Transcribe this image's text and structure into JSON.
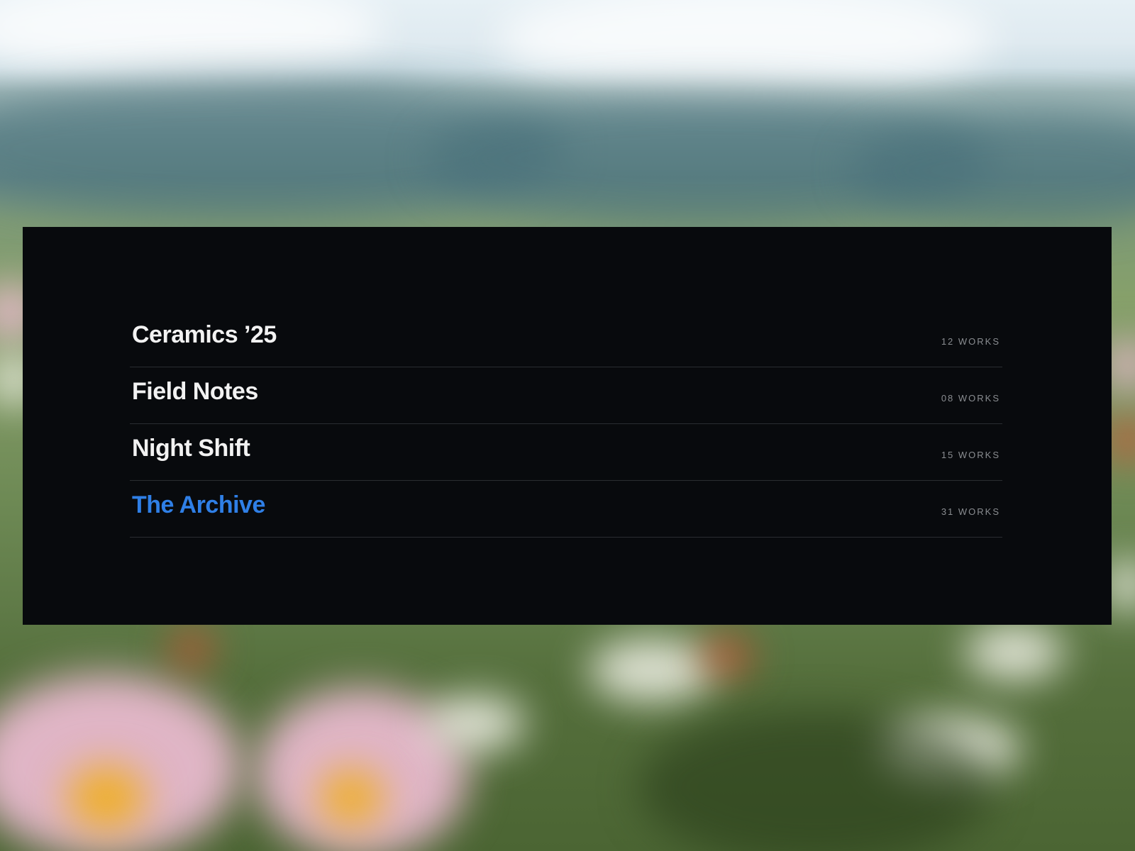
{
  "collections": [
    {
      "title": "Ceramics ’25",
      "count": "12 WORKS",
      "active": false
    },
    {
      "title": "Field Notes",
      "count": "08 WORKS",
      "active": false
    },
    {
      "title": "Night Shift",
      "count": "15 WORKS",
      "active": false
    },
    {
      "title": "The Archive",
      "count": "31 WORKS",
      "active": true
    }
  ],
  "colors": {
    "panel_background": "#080a0d",
    "title_text": "#f2f2f2",
    "active_accent": "#2f7fe6",
    "count_text": "#8a8d91",
    "divider": "#2a2d31"
  }
}
